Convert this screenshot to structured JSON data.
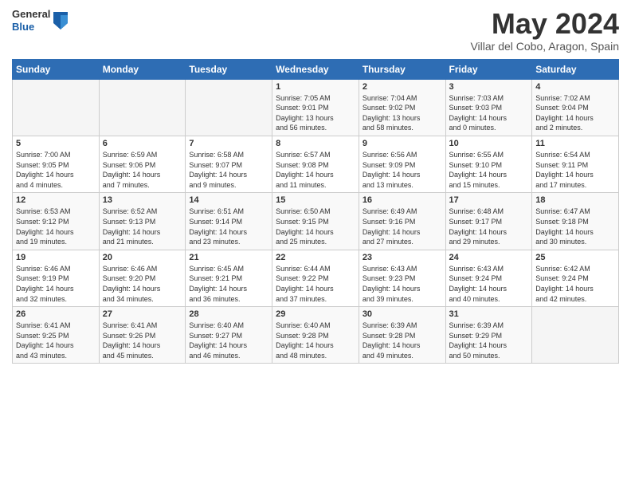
{
  "header": {
    "logo_general": "General",
    "logo_blue": "Blue",
    "month_title": "May 2024",
    "location": "Villar del Cobo, Aragon, Spain"
  },
  "weekdays": [
    "Sunday",
    "Monday",
    "Tuesday",
    "Wednesday",
    "Thursday",
    "Friday",
    "Saturday"
  ],
  "weeks": [
    [
      {
        "day": "",
        "info": ""
      },
      {
        "day": "",
        "info": ""
      },
      {
        "day": "",
        "info": ""
      },
      {
        "day": "1",
        "info": "Sunrise: 7:05 AM\nSunset: 9:01 PM\nDaylight: 13 hours\nand 56 minutes."
      },
      {
        "day": "2",
        "info": "Sunrise: 7:04 AM\nSunset: 9:02 PM\nDaylight: 13 hours\nand 58 minutes."
      },
      {
        "day": "3",
        "info": "Sunrise: 7:03 AM\nSunset: 9:03 PM\nDaylight: 14 hours\nand 0 minutes."
      },
      {
        "day": "4",
        "info": "Sunrise: 7:02 AM\nSunset: 9:04 PM\nDaylight: 14 hours\nand 2 minutes."
      }
    ],
    [
      {
        "day": "5",
        "info": "Sunrise: 7:00 AM\nSunset: 9:05 PM\nDaylight: 14 hours\nand 4 minutes."
      },
      {
        "day": "6",
        "info": "Sunrise: 6:59 AM\nSunset: 9:06 PM\nDaylight: 14 hours\nand 7 minutes."
      },
      {
        "day": "7",
        "info": "Sunrise: 6:58 AM\nSunset: 9:07 PM\nDaylight: 14 hours\nand 9 minutes."
      },
      {
        "day": "8",
        "info": "Sunrise: 6:57 AM\nSunset: 9:08 PM\nDaylight: 14 hours\nand 11 minutes."
      },
      {
        "day": "9",
        "info": "Sunrise: 6:56 AM\nSunset: 9:09 PM\nDaylight: 14 hours\nand 13 minutes."
      },
      {
        "day": "10",
        "info": "Sunrise: 6:55 AM\nSunset: 9:10 PM\nDaylight: 14 hours\nand 15 minutes."
      },
      {
        "day": "11",
        "info": "Sunrise: 6:54 AM\nSunset: 9:11 PM\nDaylight: 14 hours\nand 17 minutes."
      }
    ],
    [
      {
        "day": "12",
        "info": "Sunrise: 6:53 AM\nSunset: 9:12 PM\nDaylight: 14 hours\nand 19 minutes."
      },
      {
        "day": "13",
        "info": "Sunrise: 6:52 AM\nSunset: 9:13 PM\nDaylight: 14 hours\nand 21 minutes."
      },
      {
        "day": "14",
        "info": "Sunrise: 6:51 AM\nSunset: 9:14 PM\nDaylight: 14 hours\nand 23 minutes."
      },
      {
        "day": "15",
        "info": "Sunrise: 6:50 AM\nSunset: 9:15 PM\nDaylight: 14 hours\nand 25 minutes."
      },
      {
        "day": "16",
        "info": "Sunrise: 6:49 AM\nSunset: 9:16 PM\nDaylight: 14 hours\nand 27 minutes."
      },
      {
        "day": "17",
        "info": "Sunrise: 6:48 AM\nSunset: 9:17 PM\nDaylight: 14 hours\nand 29 minutes."
      },
      {
        "day": "18",
        "info": "Sunrise: 6:47 AM\nSunset: 9:18 PM\nDaylight: 14 hours\nand 30 minutes."
      }
    ],
    [
      {
        "day": "19",
        "info": "Sunrise: 6:46 AM\nSunset: 9:19 PM\nDaylight: 14 hours\nand 32 minutes."
      },
      {
        "day": "20",
        "info": "Sunrise: 6:46 AM\nSunset: 9:20 PM\nDaylight: 14 hours\nand 34 minutes."
      },
      {
        "day": "21",
        "info": "Sunrise: 6:45 AM\nSunset: 9:21 PM\nDaylight: 14 hours\nand 36 minutes."
      },
      {
        "day": "22",
        "info": "Sunrise: 6:44 AM\nSunset: 9:22 PM\nDaylight: 14 hours\nand 37 minutes."
      },
      {
        "day": "23",
        "info": "Sunrise: 6:43 AM\nSunset: 9:23 PM\nDaylight: 14 hours\nand 39 minutes."
      },
      {
        "day": "24",
        "info": "Sunrise: 6:43 AM\nSunset: 9:24 PM\nDaylight: 14 hours\nand 40 minutes."
      },
      {
        "day": "25",
        "info": "Sunrise: 6:42 AM\nSunset: 9:24 PM\nDaylight: 14 hours\nand 42 minutes."
      }
    ],
    [
      {
        "day": "26",
        "info": "Sunrise: 6:41 AM\nSunset: 9:25 PM\nDaylight: 14 hours\nand 43 minutes."
      },
      {
        "day": "27",
        "info": "Sunrise: 6:41 AM\nSunset: 9:26 PM\nDaylight: 14 hours\nand 45 minutes."
      },
      {
        "day": "28",
        "info": "Sunrise: 6:40 AM\nSunset: 9:27 PM\nDaylight: 14 hours\nand 46 minutes."
      },
      {
        "day": "29",
        "info": "Sunrise: 6:40 AM\nSunset: 9:28 PM\nDaylight: 14 hours\nand 48 minutes."
      },
      {
        "day": "30",
        "info": "Sunrise: 6:39 AM\nSunset: 9:28 PM\nDaylight: 14 hours\nand 49 minutes."
      },
      {
        "day": "31",
        "info": "Sunrise: 6:39 AM\nSunset: 9:29 PM\nDaylight: 14 hours\nand 50 minutes."
      },
      {
        "day": "",
        "info": ""
      }
    ]
  ]
}
